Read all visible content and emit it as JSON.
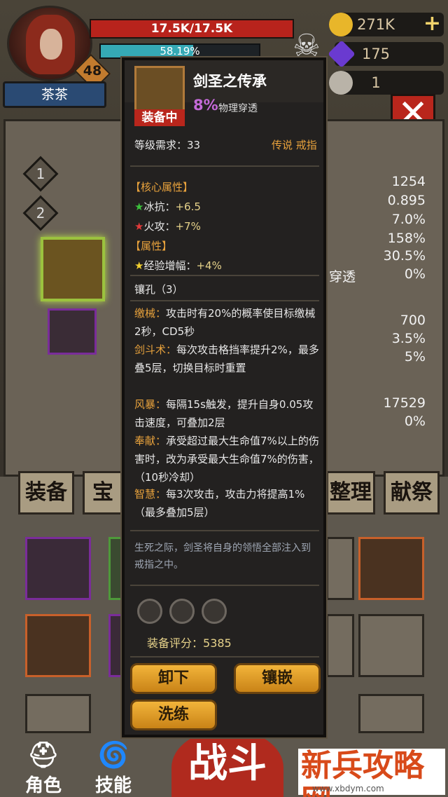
{
  "player": {
    "name": "茶茶",
    "level": "48",
    "hp": "17.5K/17.5K",
    "xp_pct": "58.19%",
    "xp_fraction": 0.5819
  },
  "currency": {
    "gold": "271K",
    "crystal": "175",
    "scroll": "1"
  },
  "side": {
    "slot1": "1",
    "slot2": "2"
  },
  "bg_stats": {
    "right_values": [
      "1254",
      "0.895",
      "7.0%",
      "158%",
      "30.5%",
      "0%",
      "700",
      "3.5%",
      "5%",
      "17529",
      "0%"
    ],
    "faint_label": "穿透"
  },
  "tabs": {
    "equip": "装备",
    "treasure": "宝石",
    "sort": "整理",
    "sacrifice": "献祭"
  },
  "nav": {
    "character": "角色",
    "skill": "技能",
    "fight": "战斗"
  },
  "watermark": {
    "title": "新兵攻略网",
    "url": "www.xbdym.com"
  },
  "item": {
    "name": "剑圣之传承",
    "status": "装备中",
    "pierce_value": "8%",
    "pierce_label": "物理穿透",
    "req_label": "等级需求：",
    "req_value": "33",
    "rarity": "传说 戒指",
    "core_header": "【核心属性】",
    "core": [
      {
        "star": "★",
        "star_color": "#3cc23c",
        "name": "冰抗：",
        "value": "+6.5"
      },
      {
        "star": "★",
        "star_color": "#e23a3a",
        "name": "火攻：",
        "value": "+7%"
      }
    ],
    "attr_header": "【属性】",
    "attr": [
      {
        "star": "★",
        "star_color": "#f2d030",
        "name": "经验增幅：",
        "value": "+4%"
      }
    ],
    "sockets_label": "镶孔（3）",
    "effects": [
      {
        "key": "缴械：",
        "text": "攻击时有20%的概率使目标缴械2秒，CD5秒"
      },
      {
        "key": "剑斗术：",
        "text": "每次攻击格挡率提升2%，最多叠5层，切换目标时重置"
      },
      {
        "key": "风暴：",
        "text": "每隔15s触发，提升自身0.05攻击速度，可叠加2层"
      },
      {
        "key": "奉献：",
        "text": "承受超过最大生命值7%以上的伤害时，改为承受最大生命值7%的伤害，（10秒冷却）"
      },
      {
        "key": "智慧：",
        "text": "每3次攻击，攻击力将提高1%（最多叠加5层）"
      }
    ],
    "flavor": "生死之际，剑圣将自身的领悟全部注入到戒指之中。",
    "score_label": "装备评分：",
    "score_value": "5385",
    "buttons": {
      "unequip": "卸下",
      "inlay": "镶嵌",
      "refine": "洗练"
    }
  }
}
